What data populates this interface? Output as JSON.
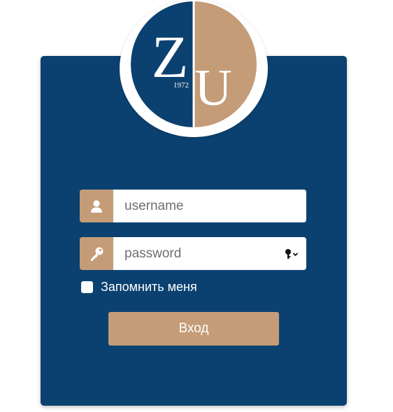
{
  "logo": {
    "letter_left": "Z",
    "letter_right": "U",
    "year": "1972",
    "color_left": "#0b4170",
    "color_right": "#c49c77"
  },
  "form": {
    "username": {
      "placeholder": "username",
      "value": "",
      "icon": "user-icon"
    },
    "password": {
      "placeholder": "password",
      "value": "",
      "icon": "key-icon",
      "manager_icon": "password-key-dropdown-icon"
    },
    "remember": {
      "label": "Запомнить меня",
      "checked": false
    },
    "submit_label": "Вход"
  },
  "colors": {
    "card_background": "#0b4170",
    "accent": "#c49c77",
    "page_background": "#ffffff"
  }
}
